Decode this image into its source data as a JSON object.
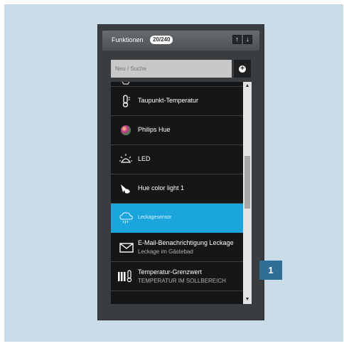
{
  "panel": {
    "title": "Funktionen",
    "count": "20/240",
    "sort_up": "↑",
    "sort_down": "↓"
  },
  "search": {
    "placeholder": "Neu / Suche",
    "add_label": "+"
  },
  "items": [
    {
      "label": "",
      "icon": "partial-item-icon"
    },
    {
      "label": "Taupunkt-Temperatur",
      "icon": "thermometer-icon"
    },
    {
      "label": "Philips Hue",
      "icon": "color-ball-icon"
    },
    {
      "label": "LED",
      "icon": "led-bulb-icon"
    },
    {
      "label": "Hue color light 1",
      "icon": "lamp-icon"
    },
    {
      "label": "Leckagesensor",
      "icon": "leak-cloud-icon",
      "selected": true
    },
    {
      "label": "E-Mail-Benachrichtigung Leckage",
      "sub": "Leckage im Gästebad",
      "icon": "envelope-icon"
    },
    {
      "label": "Temperatur-Grenzwert",
      "sub": "TEMPERATUR IM SOLLBEREICH",
      "icon": "heater-thermometer-icon"
    }
  ],
  "scrollbar": {
    "up": "▲",
    "down": "▼"
  },
  "callout": {
    "label": "1"
  },
  "colors": {
    "accent": "#1aa6dc",
    "background": "#c9dce7",
    "panel": "#3a3d40",
    "callout": "#2f6f96"
  }
}
